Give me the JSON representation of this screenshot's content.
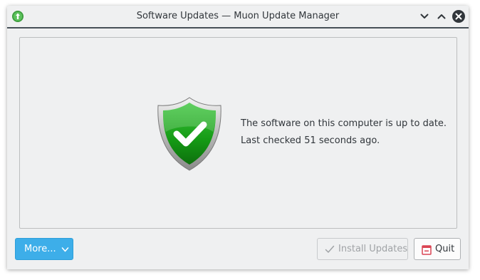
{
  "window": {
    "title": "Software Updates — Muon Update Manager"
  },
  "titlebar": {
    "app_icon": "muon-update-icon",
    "minimize_icon": "chevron-down-icon",
    "maximize_icon": "chevron-up-icon",
    "close_icon": "close-icon"
  },
  "status": {
    "icon": "shield-check-icon",
    "message": "The software on this computer is up to date.",
    "last_checked": "Last checked 51 seconds ago."
  },
  "buttons": {
    "more_label": "More...",
    "install_label": "Install Updates",
    "quit_label": "Quit"
  },
  "colors": {
    "accent": "#3daee9",
    "shield_green": "#1e9e1e",
    "quit_icon_red": "#da4453"
  }
}
